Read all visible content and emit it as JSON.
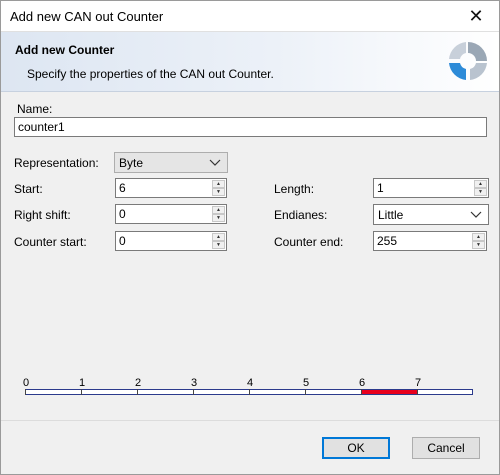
{
  "window": {
    "title": "Add new CAN out Counter",
    "close_glyph": "✕"
  },
  "header": {
    "title": "Add new Counter",
    "subtitle": "Specify the properties of the CAN out Counter.",
    "logo_icon": "wizard-logo-icon"
  },
  "form": {
    "name": {
      "label": "Name:",
      "value": "counter1"
    },
    "representation": {
      "label": "Representation:",
      "value": "Byte"
    },
    "start": {
      "label": "Start:",
      "value": "6"
    },
    "length": {
      "label": "Length:",
      "value": "1"
    },
    "right_shift": {
      "label": "Right shift:",
      "value": "0"
    },
    "endianes": {
      "label": "Endianes:",
      "value": "Little"
    },
    "counter_start": {
      "label": "Counter start:",
      "value": "0"
    },
    "counter_end": {
      "label": "Counter end:",
      "value": "255"
    }
  },
  "bit_ruler": {
    "labels": [
      "0",
      "1",
      "2",
      "3",
      "4",
      "5",
      "6",
      "7"
    ],
    "selected_bits": [
      6
    ],
    "bit_count": 8,
    "selection_color": "#e8001c"
  },
  "buttons": {
    "ok": "OK",
    "cancel": "Cancel"
  },
  "colors": {
    "accent": "#0078d7",
    "header_gradient_start": "#dde6f2"
  }
}
